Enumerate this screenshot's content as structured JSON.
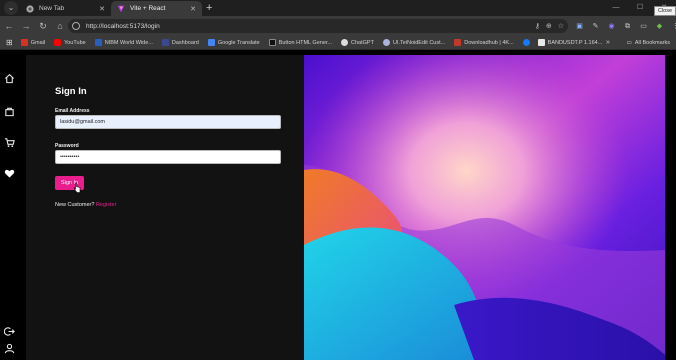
{
  "browser": {
    "tabs": [
      {
        "label": "New Tab",
        "active": false,
        "favicon": "chrome-icon"
      },
      {
        "label": "Vite + React",
        "active": true,
        "favicon": "vite-icon"
      }
    ],
    "url": "http://localhost:5173/login",
    "close_tooltip": "Close",
    "bookmarks": [
      {
        "label": "Gmail",
        "icon": "gmail-icon",
        "color": "#d93025"
      },
      {
        "label": "YouTube",
        "icon": "youtube-icon",
        "color": "#ff0000"
      },
      {
        "label": "NIBM World Wide...",
        "icon": "nibm-icon",
        "color": "#2b5fbf"
      },
      {
        "label": "Dashboard",
        "icon": "dashboard-icon",
        "color": "#3b4a8f"
      },
      {
        "label": "Google Translate",
        "icon": "translate-icon",
        "color": "#4285f4"
      },
      {
        "label": "Button HTML Gener...",
        "icon": "button-gen-icon",
        "color": "#1a1a1a"
      },
      {
        "label": "ChatGPT",
        "icon": "chatgpt-icon",
        "color": "#dcdcdc"
      },
      {
        "label": "UI.TeiNoidEdit Cust...",
        "icon": "ui-icon",
        "color": "#aab4d8"
      },
      {
        "label": "Downloadhub | 4K...",
        "icon": "download-icon",
        "color": "#c0392b"
      },
      {
        "label": "",
        "icon": "facebook-icon",
        "color": "#1877f2"
      },
      {
        "label": "BANDUSDT.P 1.164...",
        "icon": "tradingview-icon",
        "color": "#e8e8e8"
      }
    ],
    "all_bookmarks_label": "All Bookmarks"
  },
  "login": {
    "title": "Sign In",
    "email_label": "Email Address",
    "email_value": "lasidu@gmail.com",
    "password_label": "Password",
    "password_value": "••••••••••",
    "signin_label": "Sign In",
    "new_customer_text": "New Customer?",
    "register_label": "Register"
  },
  "sidebar_icons": [
    "home-icon",
    "bag-icon",
    "cart-icon",
    "heart-icon",
    "logout-icon",
    "user-icon"
  ],
  "colors": {
    "accent": "#e91e8c",
    "page_bg": "#121212",
    "browser_chrome": "#3a3a3a"
  }
}
